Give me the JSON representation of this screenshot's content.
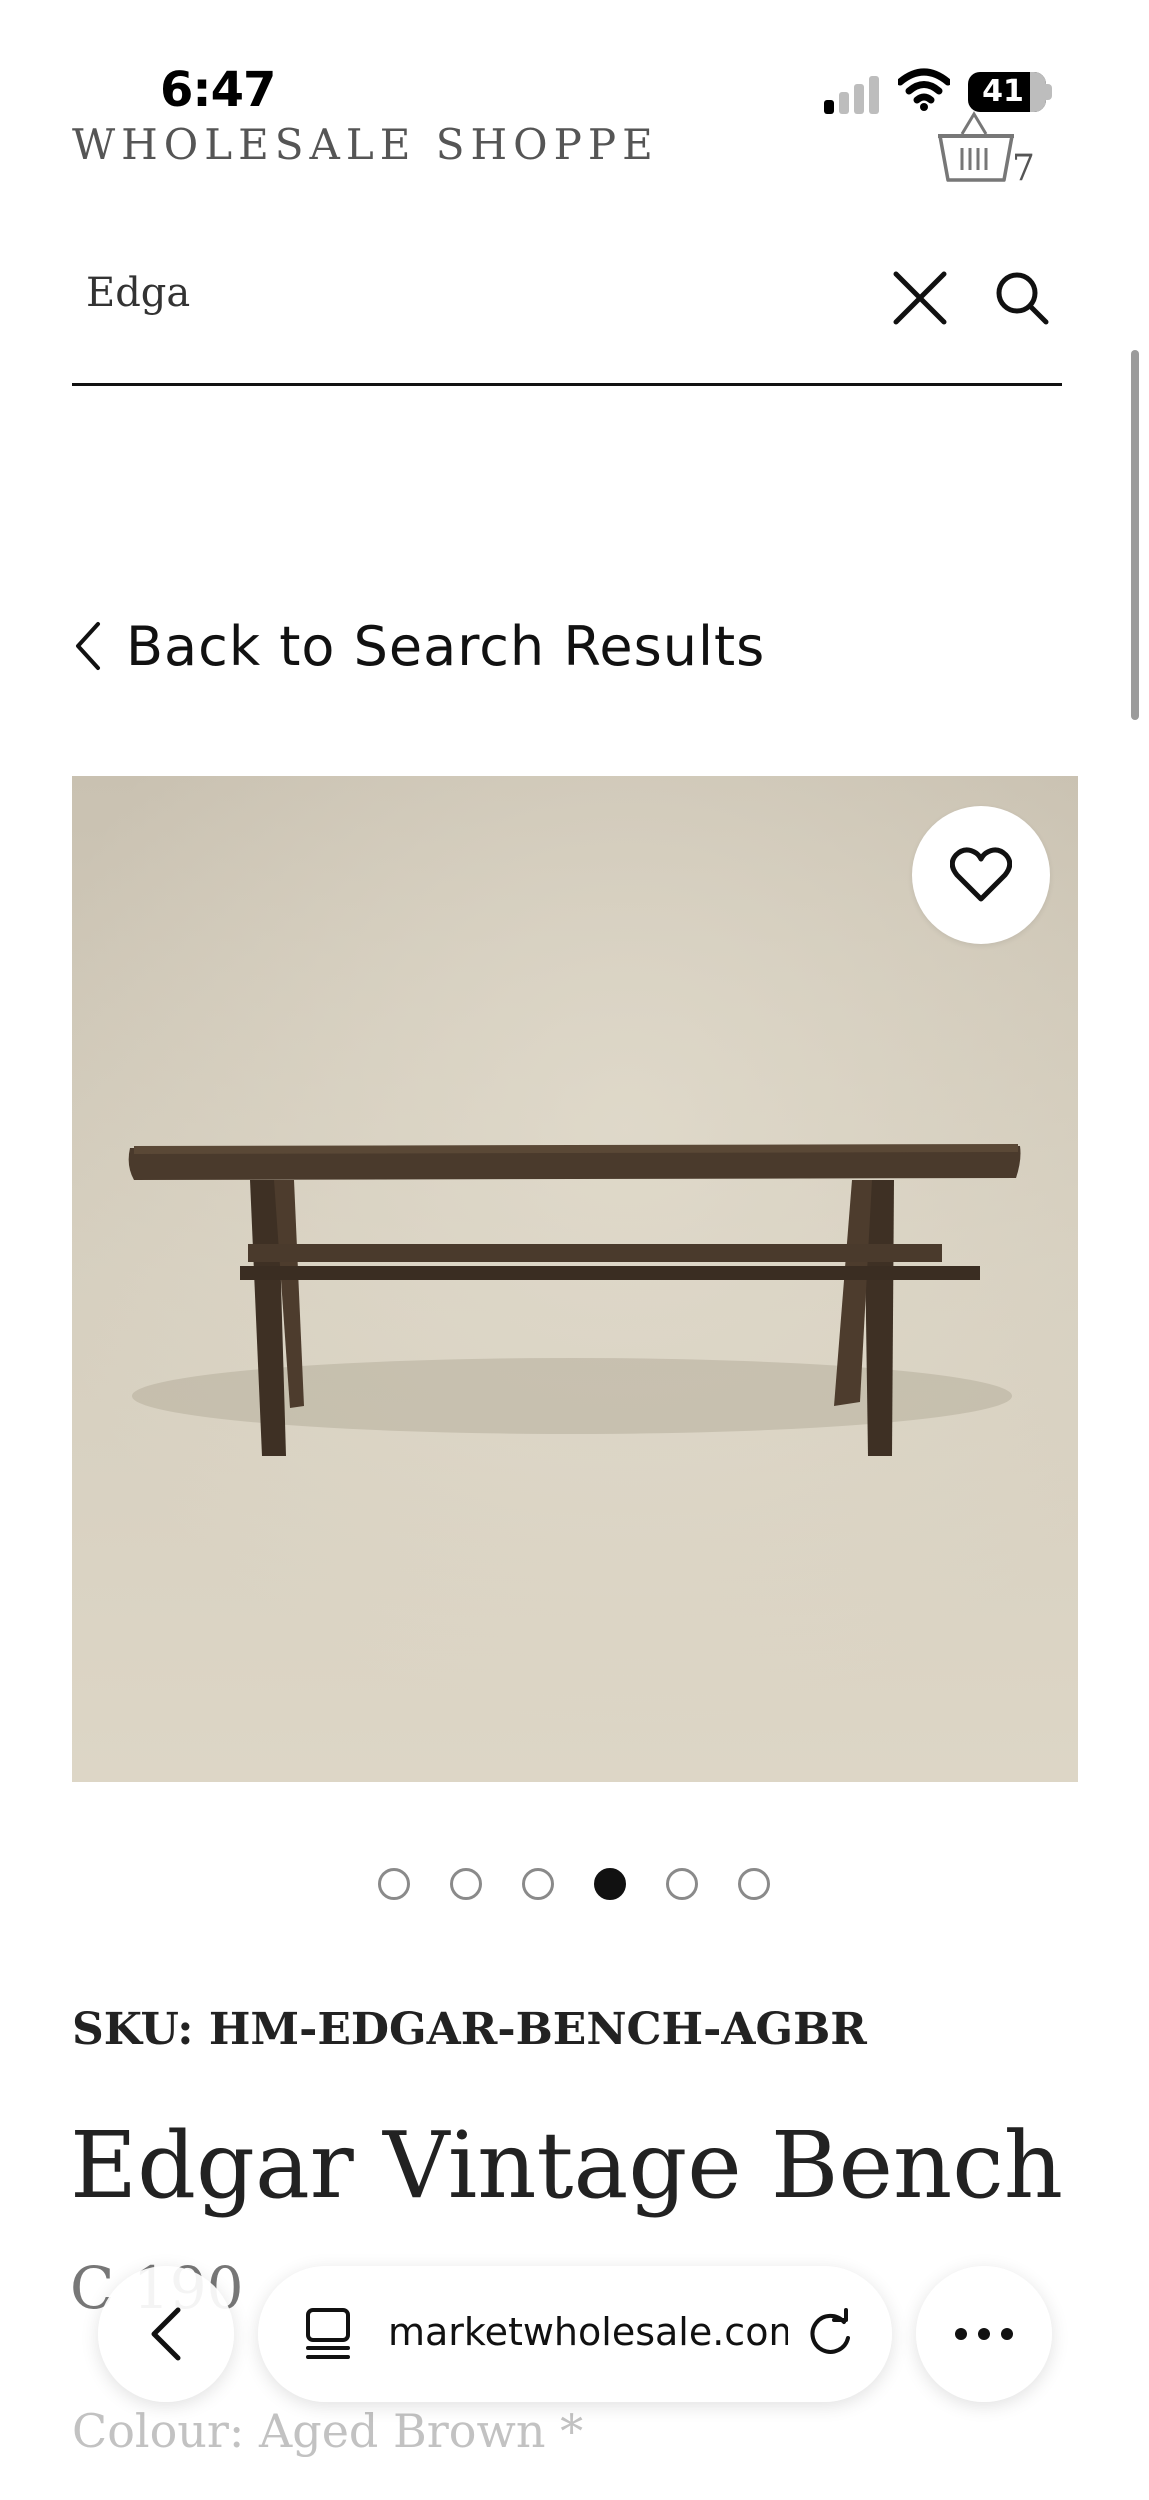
{
  "status_bar": {
    "time": "6:47",
    "battery": "41"
  },
  "header": {
    "brand": "WHOLESALE SHOPPE",
    "cart_count": "7"
  },
  "search": {
    "value": "Edga"
  },
  "nav": {
    "back_label": "Back to Search Results"
  },
  "product": {
    "sku": "SKU: HM-EDGAR-BENCH-AGBR",
    "title": "Edgar Vintage Bench",
    "code_partial": "C   190",
    "colour_label": "Colour: Aged Brown *",
    "image_count": 6,
    "active_image_index": 3
  },
  "browser": {
    "url": "marketwholesale.com"
  },
  "colors": {
    "accent": "#111111",
    "brand_text": "#555555",
    "muted_text": "#c2c2c2",
    "image_bg": "#cdc6b6",
    "wood": "#4a3a2c"
  }
}
